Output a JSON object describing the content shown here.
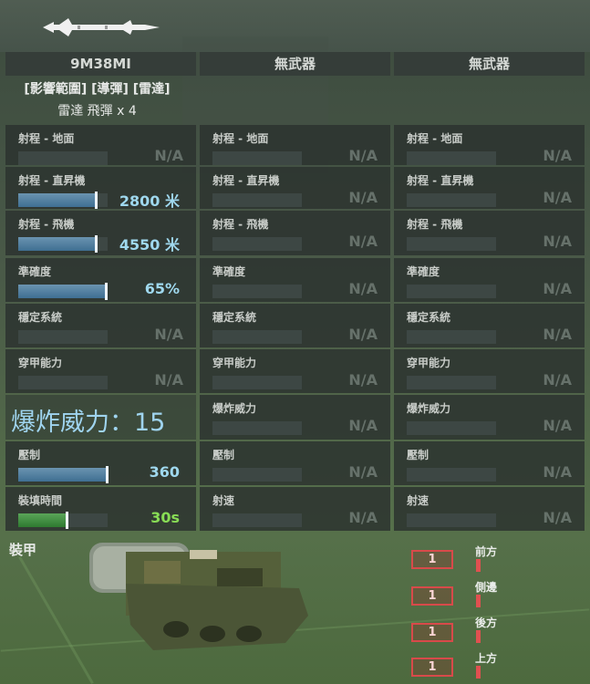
{
  "header": {
    "icon": "missile-icon"
  },
  "columns": [
    {
      "title": "9M38MI",
      "tags": "[影響範圍] [導彈] [雷達]",
      "ammo": "雷達 飛彈 x 4",
      "stats": [
        {
          "label": "射程 - 地面",
          "value": "N/A",
          "na": true
        },
        {
          "label": "射程 - 直昇機",
          "value": "2800 米",
          "fill": 0.88
        },
        {
          "label": "射程 - 飛機",
          "value": "4550 米",
          "fill": 0.88
        },
        {
          "label": "準確度",
          "value": "65%",
          "fill": 0.99
        },
        {
          "label": "穩定系統",
          "value": "N/A",
          "na": true
        },
        {
          "label": "穿甲能力",
          "value": "N/A",
          "na": true
        },
        {
          "label": "爆炸威力：15",
          "value": ""
        },
        {
          "label": "壓制",
          "value": "360",
          "fill": 1.0
        },
        {
          "label": "裝填時間",
          "value": "30s",
          "fill": 0.55,
          "color": "green"
        }
      ]
    },
    {
      "title": "無武器",
      "stats": [
        {
          "label": "射程 - 地面",
          "value": "N/A",
          "na": true
        },
        {
          "label": "射程 - 直昇機",
          "value": "N/A",
          "na": true
        },
        {
          "label": "射程 - 飛機",
          "value": "N/A",
          "na": true
        },
        {
          "label": "準確度",
          "value": "N/A",
          "na": true
        },
        {
          "label": "穩定系統",
          "value": "N/A",
          "na": true
        },
        {
          "label": "穿甲能力",
          "value": "N/A",
          "na": true
        },
        {
          "label": "爆炸威力",
          "value": "N/A",
          "na": true
        },
        {
          "label": "壓制",
          "value": "N/A",
          "na": true
        },
        {
          "label": "射速",
          "value": "N/A",
          "na": true
        }
      ]
    },
    {
      "title": "無武器",
      "stats": [
        {
          "label": "射程 - 地面",
          "value": "N/A",
          "na": true
        },
        {
          "label": "射程 - 直昇機",
          "value": "N/A",
          "na": true
        },
        {
          "label": "射程 - 飛機",
          "value": "N/A",
          "na": true
        },
        {
          "label": "準確度",
          "value": "N/A",
          "na": true
        },
        {
          "label": "穩定系統",
          "value": "N/A",
          "na": true
        },
        {
          "label": "穿甲能力",
          "value": "N/A",
          "na": true
        },
        {
          "label": "爆炸威力",
          "value": "N/A",
          "na": true
        },
        {
          "label": "壓制",
          "value": "N/A",
          "na": true
        },
        {
          "label": "射速",
          "value": "N/A",
          "na": true
        }
      ]
    }
  ],
  "armor": {
    "label": "裝甲",
    "sides": [
      {
        "label": "前方",
        "value": "1"
      },
      {
        "label": "側邊",
        "value": "1"
      },
      {
        "label": "後方",
        "value": "1"
      },
      {
        "label": "上方",
        "value": "1"
      }
    ]
  },
  "colors": {
    "accent_blue": "#9fd8ee",
    "accent_green": "#88dd55",
    "armor_red": "#d84a4a"
  }
}
